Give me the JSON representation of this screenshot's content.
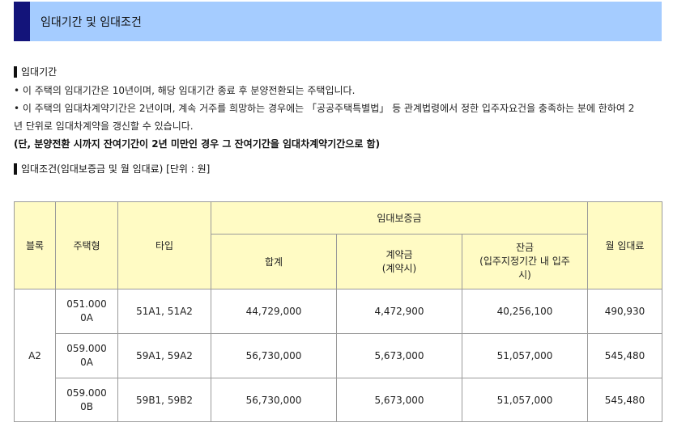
{
  "header": {
    "title": "임대기간 및 임대조건"
  },
  "period": {
    "heading": "임대기간",
    "line1": "• 이 주택의 임대기간은 10년이며, 해당 임대기간 종료 후 분양전환되는 주택입니다.",
    "line2": "• 이 주택의 임대차계약기간은 2년이며, 계속 거주를 희망하는 경우에는 「공공주택특별법」 등 관계법령에서 정한 입주자요건을 충족하는 분에 한하여 2",
    "line3": "년 단위로 임대차계약을 갱신할 수 있습니다.",
    "note": "(단, 분양전환 시까지 잔여기간이 2년 미만인 경우 그 잔여기간을 임대차계약기간으로 함)"
  },
  "conditions": {
    "heading": "임대조건(임대보증금 및 월 임대료) [단위 : 원]"
  },
  "table": {
    "headers": {
      "block": "블록",
      "house_type": "주택형",
      "type": "타입",
      "deposit": "임대보증금",
      "total": "합계",
      "contract_line1": "계약금",
      "contract_line2": "(계약시)",
      "balance_line1": "잔금",
      "balance_line2": "(입주지정기간 내 입주",
      "balance_line3": "시)",
      "monthly": "월 임대료"
    },
    "block_value": "A2",
    "rows": [
      {
        "house_type_line1": "051.000",
        "house_type_line2": "0A",
        "type": "51A1, 51A2",
        "total": "44,729,000",
        "contract": "4,472,900",
        "balance": "40,256,100",
        "monthly": "490,930"
      },
      {
        "house_type_line1": "059.000",
        "house_type_line2": "0A",
        "type": "59A1, 59A2",
        "total": "56,730,000",
        "contract": "5,673,000",
        "balance": "51,057,000",
        "monthly": "545,480"
      },
      {
        "house_type_line1": "059.000",
        "house_type_line2": "0B",
        "type": "59B1, 59B2",
        "total": "56,730,000",
        "contract": "5,673,000",
        "balance": "51,057,000",
        "monthly": "545,480"
      }
    ]
  }
}
